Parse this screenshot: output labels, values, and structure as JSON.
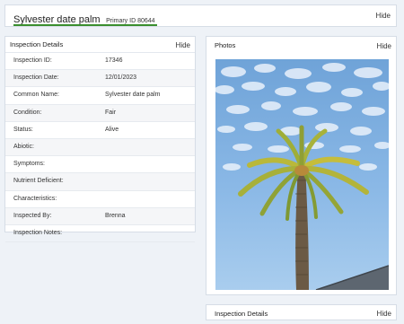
{
  "header": {
    "title": "Sylvester date palm",
    "subtitle": "Primary ID 80644",
    "hide_label": "Hide",
    "accent_color": "#3a8f2e"
  },
  "details": {
    "title": "Inspection Details",
    "hide_label": "Hide",
    "rows": [
      {
        "label": "Inspection ID:",
        "value": "17346"
      },
      {
        "label": "Inspection Date:",
        "value": "12/01/2023"
      },
      {
        "label": "Common Name:",
        "value": "Sylvester date palm"
      },
      {
        "label": "Condition:",
        "value": "Fair"
      },
      {
        "label": "Status:",
        "value": "Alive"
      },
      {
        "label": "Abiotic:",
        "value": ""
      },
      {
        "label": "Symptoms:",
        "value": ""
      },
      {
        "label": "Nutrient Deficient:",
        "value": ""
      },
      {
        "label": "Characteristics:",
        "value": ""
      },
      {
        "label": "Inspected By:",
        "value": "Brenna"
      },
      {
        "label": "Inspection Notes:",
        "value": ""
      }
    ]
  },
  "photos": {
    "title": "Photos",
    "hide_label": "Hide"
  },
  "bottom": {
    "title": "Inspection Details",
    "hide_label": "Hide"
  }
}
